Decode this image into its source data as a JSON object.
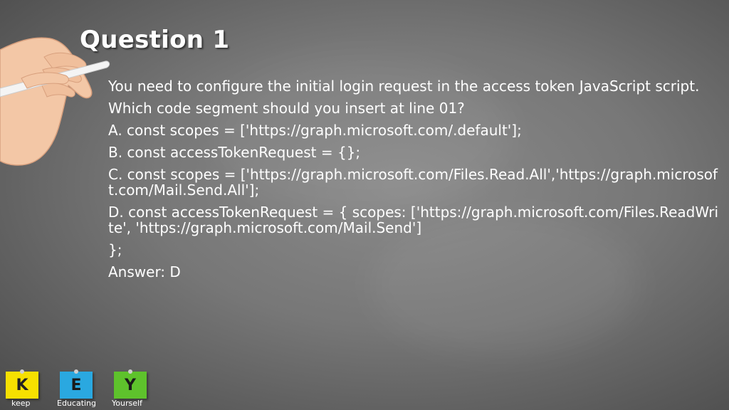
{
  "slide": {
    "title": "Question 1",
    "paragraphs": [
      "You need to configure the initial login request in the access token JavaScript script.",
      "Which code segment should you insert at line 01?",
      "A. const scopes = ['https://graph.microsoft.com/.default'];",
      "B. const accessTokenRequest = {};",
      "C. const scopes = ['https://graph.microsoft.com/Files.Read.All','https://graph.microsoft.com/Mail.Send.All'];",
      "D. const accessTokenRequest = {     scopes: ['https://graph.microsoft.com/Files.ReadWrite', 'https://graph.microsoft.com/Mail.Send']",
      "};"
    ],
    "answer": "Answer: D"
  },
  "logo": {
    "tiles": [
      {
        "letter": "K",
        "caption": "keep",
        "color": "#f6e000"
      },
      {
        "letter": "E",
        "caption": "Educating",
        "color": "#2aa8e0"
      },
      {
        "letter": "Y",
        "caption": "Yourself",
        "color": "#5ec22c"
      }
    ]
  },
  "colors": {
    "background": "#777777",
    "text": "#ffffff"
  },
  "icons": {
    "hand": "hand-holding-chalk-icon"
  }
}
